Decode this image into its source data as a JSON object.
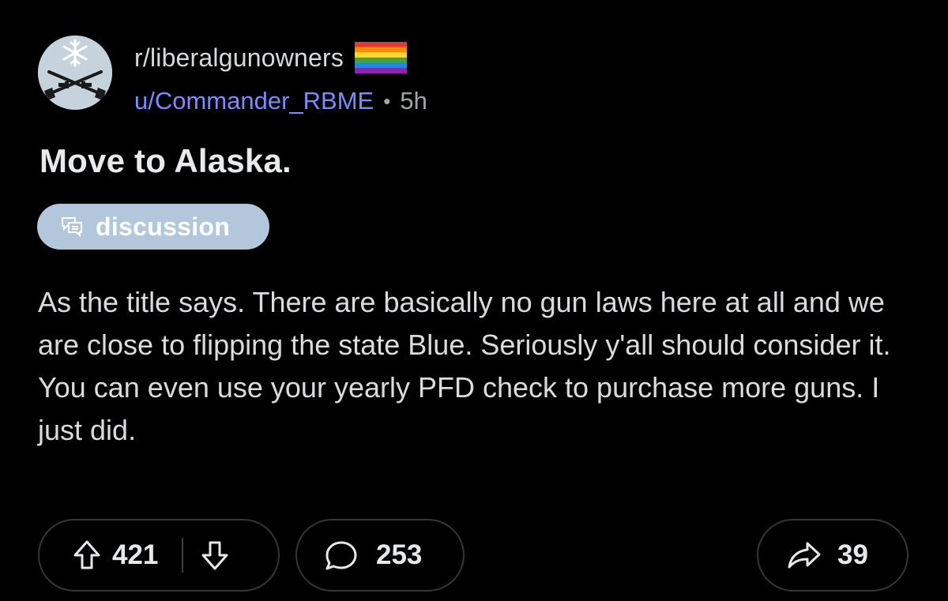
{
  "post": {
    "subreddit": "r/liberalgunowners",
    "author": "u/Commander_RBME",
    "separator": "•",
    "age": "5h",
    "title": "Move to Alaska.",
    "flair": {
      "label": "discussion",
      "icon": "chat-bubbles-icon",
      "background": "#b3c7dc"
    },
    "body": "As the title says. There are basically no gun laws here at all and we are close to flipping the state Blue. Seriously y'all should consider it. You can even use your yearly PFD check to purchase more guns. I just did."
  },
  "avatar": {
    "icon": "snowflake-crossed-rifles-icon"
  },
  "actions": {
    "upvotes": "421",
    "comments": "253",
    "shares": "39"
  },
  "colors": {
    "background": "#000000",
    "username": "#7c8cff",
    "muted": "#a0a7ab"
  }
}
